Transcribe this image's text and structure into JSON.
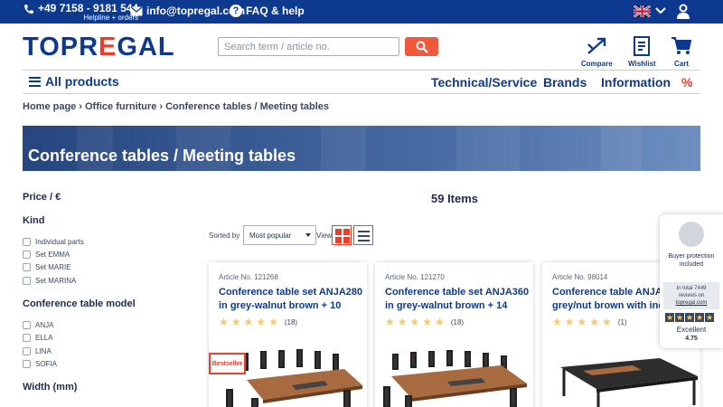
{
  "topbar": {
    "phone": "+49 7158 - 9181 544",
    "phone_sub": "Helpline + orders",
    "email": "info@topregal.com",
    "faq": "FAQ & help",
    "language_flag": "uk-flag-icon"
  },
  "header": {
    "logo": {
      "part1": "TOPR",
      "accent": "E",
      "part2": "GAL"
    },
    "search_placeholder": "Search term / article no.",
    "icons": {
      "compare": "Compare",
      "wishlist": "Wishlist",
      "cart": "Cart"
    }
  },
  "nav": {
    "all_products": "All products",
    "items": [
      "Technical/Service",
      "Brands",
      "Information",
      "%"
    ]
  },
  "breadcrumb": [
    "Home page",
    "Office furniture",
    "Conference tables / Meeting tables"
  ],
  "banner_title": "Conference tables / Meeting tables",
  "filters": {
    "price": "Price / €",
    "kind": "Kind",
    "kind_options": [
      "Individual parts",
      "Set EMMA",
      "Set MARIE",
      "Set MARINA"
    ],
    "model": "Conference table model",
    "model_options": [
      "ANJA",
      "ELLA",
      "LINA",
      "SOFIA"
    ],
    "width": "Width (mm)"
  },
  "listing": {
    "count": "59 Items",
    "sort_label": "Sorted by",
    "sort_value": "Most popular",
    "view_label": "View"
  },
  "products": [
    {
      "article": "Article No. 121268",
      "name1": "Conference table set ANJA280",
      "name2": "in grey-walnut brown + 10",
      "rating": 5,
      "reviews": "(18)",
      "badge": "Bestseller"
    },
    {
      "article": "Article No. 121270",
      "name1": "Conference table set ANJA360",
      "name2": "in grey-walnut brown + 14",
      "rating": 5,
      "reviews": "(18)"
    },
    {
      "article": "Article No. 98014",
      "name1": "Conference table ANJA360",
      "name2": "grey/nut brown with indu",
      "rating": 5,
      "reviews": "(1)"
    }
  ],
  "trust": {
    "protection": "Buyer protection included",
    "reviews_line1": "In total 7449",
    "reviews_line2": "reviews on",
    "reviews_link": "topregal.com",
    "rating_word": "Excellent",
    "rating_value": "4.75"
  },
  "colors": {
    "brand_blue": "#0d3a8f",
    "accent_red": "#e8402a",
    "star": "#f6c86a"
  }
}
